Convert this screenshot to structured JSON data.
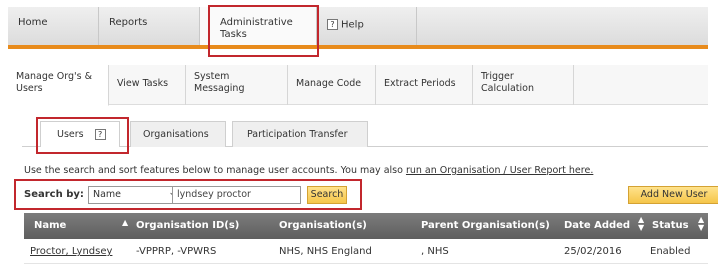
{
  "top_nav": {
    "items": [
      {
        "label": "Home"
      },
      {
        "label": "Reports"
      },
      {
        "label": "Administrative\nTasks"
      },
      {
        "label": "Help",
        "help_icon": "?"
      }
    ]
  },
  "sub_nav": {
    "items": [
      {
        "label": "Manage Org's &\nUsers"
      },
      {
        "label": "View Tasks"
      },
      {
        "label": "System\nMessaging"
      },
      {
        "label": "Manage Code"
      },
      {
        "label": "Extract Periods"
      },
      {
        "label": "Trigger\nCalculation"
      }
    ]
  },
  "tabs": [
    {
      "label": "Users",
      "help_icon": "?"
    },
    {
      "label": "Organisations"
    },
    {
      "label": "Participation Transfer"
    }
  ],
  "info": {
    "text_before": "Use the search and sort features below to manage user accounts. You may also ",
    "link": "run an Organisation / User Report here."
  },
  "search": {
    "label": "Search by:",
    "field_value": "Name",
    "query": "lyndsey proctor",
    "search_button": "Search",
    "add_button": "Add New User"
  },
  "table": {
    "columns": [
      "Name",
      "Organisation ID(s)",
      "Organisation(s)",
      "Parent Organisation(s)",
      "Date Added",
      "Status"
    ],
    "rows": [
      {
        "name": "Proctor, Lyndsey",
        "org_ids": "-VPPRP, -VPWRS",
        "orgs": "NHS, NHS England",
        "parent": ", NHS",
        "date": "25/02/2016",
        "status": "Enabled"
      }
    ]
  },
  "colors": {
    "accent_orange": "#e88b1c",
    "highlight_red": "#c2272d",
    "button_yellow": "#f5c54a",
    "header_grey": "#6c6c6c"
  }
}
